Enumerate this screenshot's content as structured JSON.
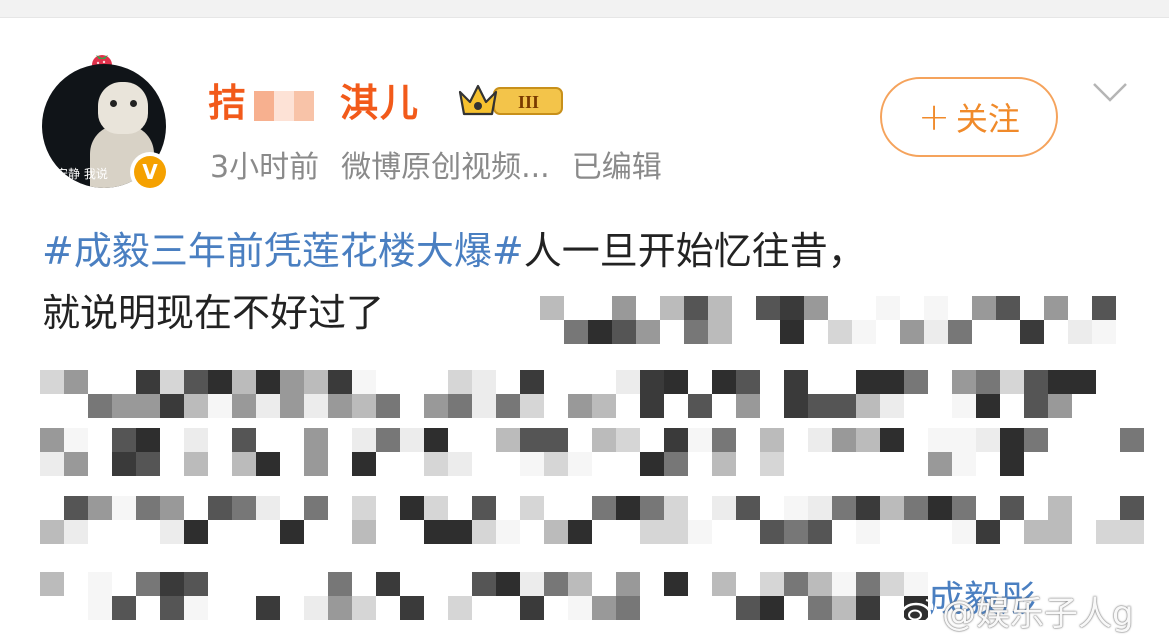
{
  "post": {
    "author": {
      "name_visible_start": "拮",
      "name_visible_end": "淇儿",
      "vip_level": "III",
      "avatar_caption": "安静 我说"
    },
    "meta": {
      "time": "3小时前",
      "source": "微博原创视频...",
      "edited": "已编辑"
    },
    "follow_label": "关注",
    "hashtag": "#成毅三年前凭莲花楼大爆#",
    "text_after_hashtag": "人一旦开始忆往昔，",
    "line2_visible": "就说明现在不好过了",
    "tail_link": "成毅彤",
    "watermark": "@娱乐子人g"
  },
  "colors": {
    "accent_orange": "#f08a2a",
    "username_orange": "#f25a1a",
    "link_blue": "#4a7fc1",
    "meta_gray": "#8a8a8a",
    "verified_gold": "#f5a100"
  },
  "icons": {
    "badge": "strawberry-icon",
    "verified": "verified-v-icon",
    "crown": "crown-vip-icon",
    "dropdown": "chevron-down-icon",
    "watermark": "weibo-logo-icon"
  }
}
